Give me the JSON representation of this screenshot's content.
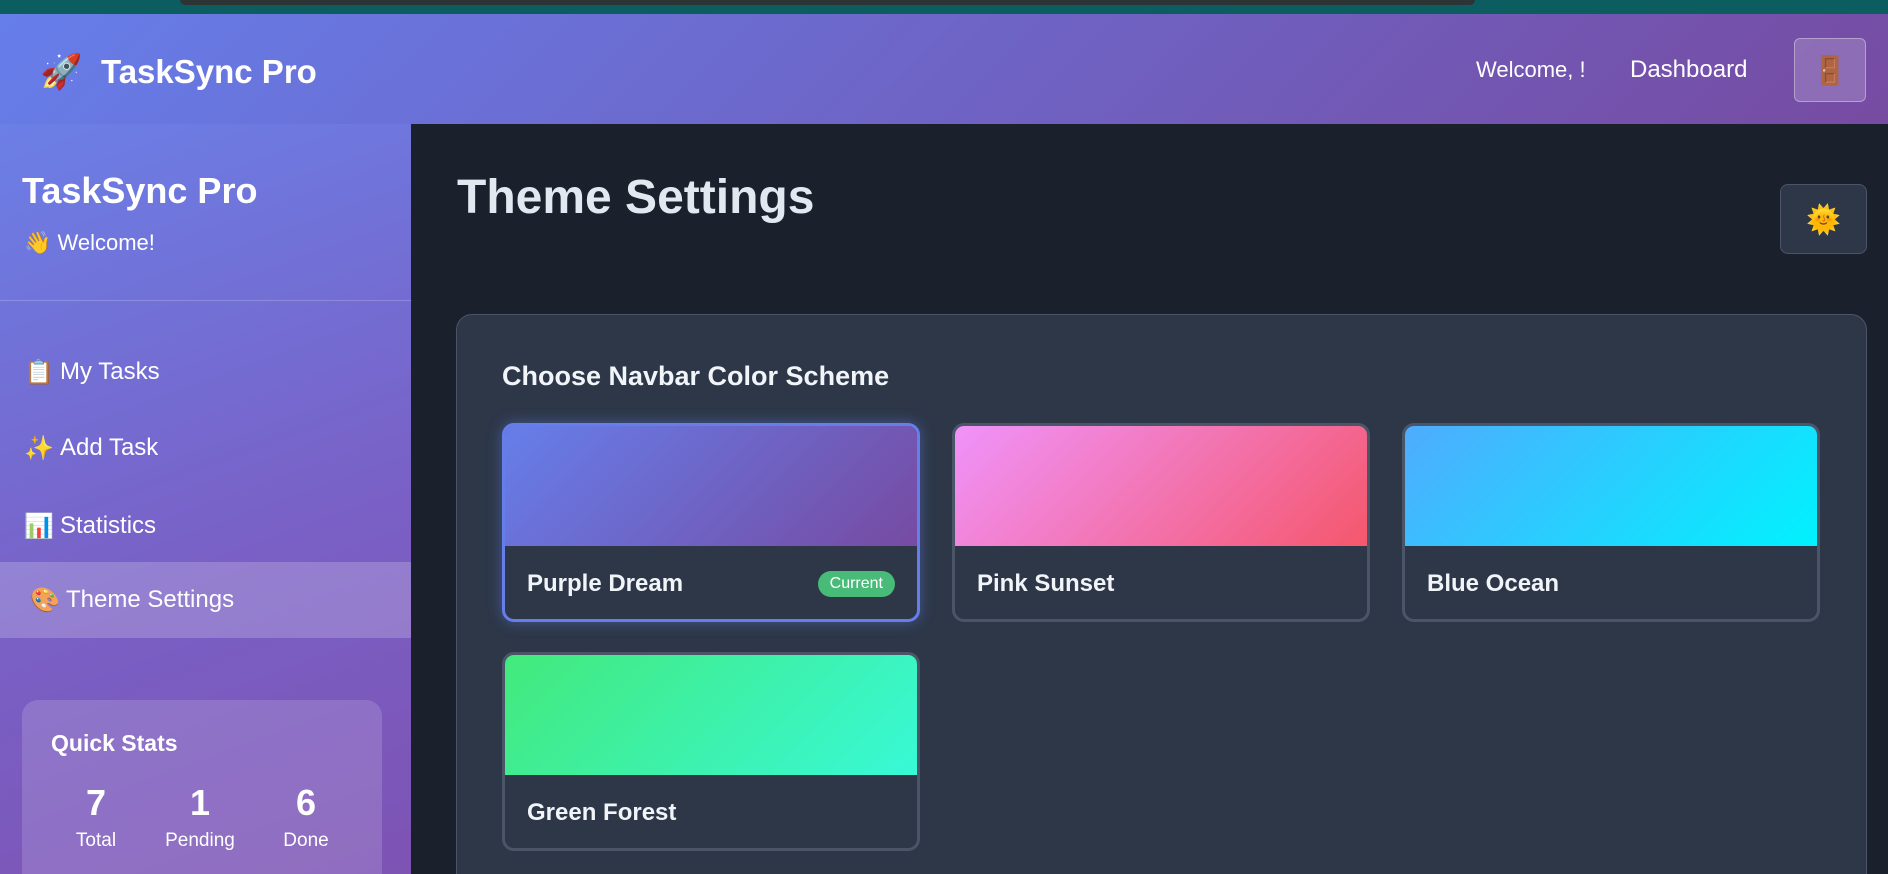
{
  "navbar": {
    "brand_icon": "rocket-icon",
    "brand": "TaskSync Pro",
    "welcome": "Welcome, !",
    "dashboard": "Dashboard",
    "logout_icon": "door-icon",
    "gradient": [
      "#667eea",
      "#764ba2"
    ]
  },
  "sidebar": {
    "title": "TaskSync Pro",
    "welcome": "👋 Welcome!",
    "items": [
      {
        "icon": "clipboard-icon",
        "glyph": "📋",
        "label": "My Tasks"
      },
      {
        "icon": "sparkle-icon",
        "glyph": "✨",
        "label": "Add Task"
      },
      {
        "icon": "chart-icon",
        "glyph": "📊",
        "label": "Statistics"
      },
      {
        "icon": "palette-icon",
        "glyph": "🎨",
        "label": "Theme Settings",
        "active": true
      }
    ],
    "quick_stats": {
      "title": "Quick Stats",
      "stats": [
        {
          "value": "7",
          "label": "Total"
        },
        {
          "value": "1",
          "label": "Pending"
        },
        {
          "value": "6",
          "label": "Done"
        }
      ]
    }
  },
  "main": {
    "title": "Theme Settings",
    "theme_toggle_icon": "sun-icon",
    "card_title": "Choose Navbar Color Scheme",
    "schemes": [
      {
        "name": "Purple Dream",
        "badge": "Current",
        "colors": [
          "#667eea",
          "#764ba2"
        ],
        "selected": true
      },
      {
        "name": "Pink Sunset",
        "colors": [
          "#f093fb",
          "#f5576c"
        ]
      },
      {
        "name": "Blue Ocean",
        "colors": [
          "#4facfe",
          "#00f2fe"
        ]
      },
      {
        "name": "Green Forest",
        "colors": [
          "#43e97b",
          "#38f9d7"
        ]
      }
    ]
  }
}
